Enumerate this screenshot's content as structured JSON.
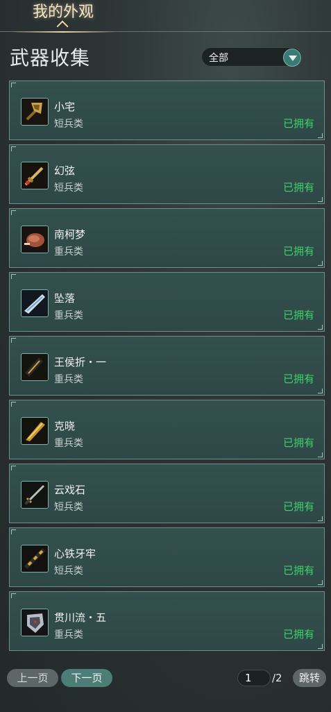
{
  "tab": {
    "label": "我的外观"
  },
  "section": {
    "title": "武器收集"
  },
  "filter": {
    "value": "全部"
  },
  "weapons": [
    {
      "name": "小宅",
      "category": "短兵类",
      "status": "已拥有",
      "icon": "axe-icon"
    },
    {
      "name": "幻弦",
      "category": "短兵类",
      "status": "已拥有",
      "icon": "sword-icon"
    },
    {
      "name": "南柯梦",
      "category": "重兵类",
      "status": "已拥有",
      "icon": "meat-icon"
    },
    {
      "name": "坠落",
      "category": "重兵类",
      "status": "已拥有",
      "icon": "blade-icon"
    },
    {
      "name": "王侯折・一",
      "category": "重兵类",
      "status": "已拥有",
      "icon": "greatsword-icon"
    },
    {
      "name": "克晓",
      "category": "重兵类",
      "status": "已拥有",
      "icon": "golden-blade-icon"
    },
    {
      "name": "云戏石",
      "category": "短兵类",
      "status": "已拥有",
      "icon": "dagger-icon"
    },
    {
      "name": "心铁牙牢",
      "category": "短兵类",
      "status": "已拥有",
      "icon": "staff-icon"
    },
    {
      "name": "贯川流・五",
      "category": "重兵类",
      "status": "已拥有",
      "icon": "shield-blade-icon"
    }
  ],
  "pagination": {
    "prev_label": "上一页",
    "next_label": "下一页",
    "current_page": "1",
    "total_label": "/2",
    "jump_label": "跳转"
  },
  "colors": {
    "status_owned": "#3ed36a",
    "accent": "#4c7d76",
    "tab_text": "#f3e6c8"
  }
}
